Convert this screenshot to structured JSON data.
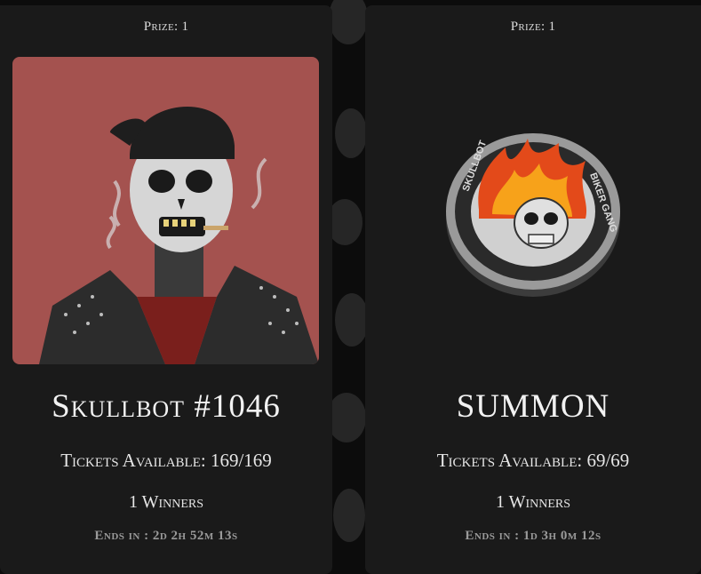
{
  "cards": [
    {
      "prize": "Prize: 1",
      "title": "Skullbot #1046",
      "image_alt": "skullbot-nft-image",
      "image_bg": "#a4524f",
      "tickets": "Tickets Available: 169/169",
      "winners": "1 Winners",
      "ends": "Ends in : 2d 2h 52m 13s"
    },
    {
      "prize": "Prize: 1",
      "title": "SUMMON",
      "image_alt": "skullbot-biker-gang-coin",
      "coin_text_left": "SKULLBOT",
      "coin_text_right": "BIKER GANG",
      "tickets": "Tickets Available: 69/69",
      "winners": "1 Winners",
      "ends": "Ends in : 1d 3h 0m 12s"
    }
  ],
  "colors": {
    "page_bg": "#0c0c0c",
    "card_bg": "#1a1a1a",
    "pattern": "#2a2a2a"
  }
}
